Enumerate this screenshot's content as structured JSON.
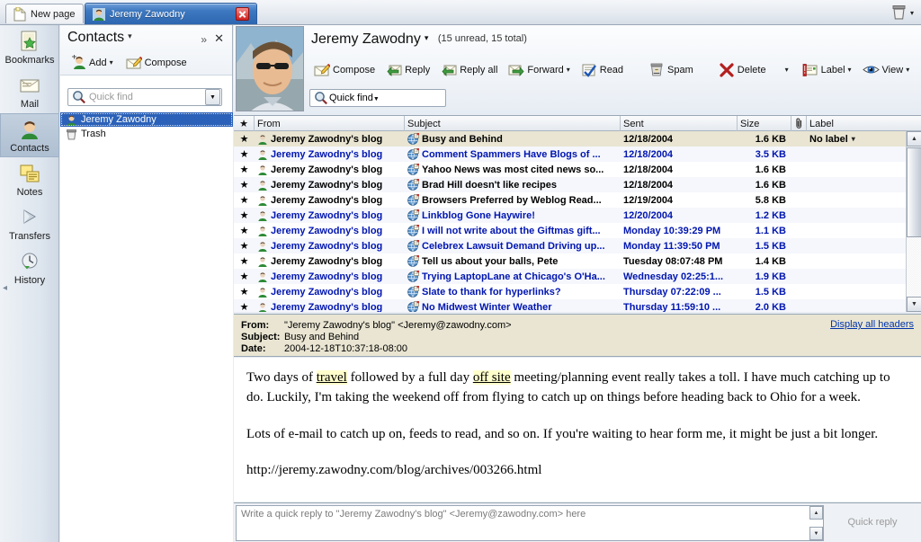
{
  "window": {
    "new_page_label": "New page",
    "active_tab_label": "Jeremy Zawodny",
    "trash_icon": "trash-icon",
    "trash_caret": "▾"
  },
  "sidebar": {
    "items": [
      {
        "label": "Bookmarks",
        "icon": "bookmarks-icon",
        "selected": false
      },
      {
        "label": "Mail",
        "icon": "mail-icon",
        "selected": false
      },
      {
        "label": "Contacts",
        "icon": "contacts-icon",
        "selected": true
      },
      {
        "label": "Notes",
        "icon": "notes-icon",
        "selected": false
      },
      {
        "label": "Transfers",
        "icon": "transfers-icon",
        "selected": false
      },
      {
        "label": "History",
        "icon": "history-icon",
        "selected": false
      }
    ],
    "collapse_arrow": "◂"
  },
  "contacts_panel": {
    "title": "Contacts",
    "title_caret": "▾",
    "expand_icon": "»",
    "close_icon": "✕",
    "add_label": "Add",
    "add_caret": "▾",
    "compose_label": "Compose",
    "quick_find_placeholder": "Quick find",
    "quick_find_value": "",
    "dropdown_caret": "▼",
    "list": [
      {
        "label": "Jeremy Zawodny",
        "icon": "person-icon",
        "selected": true
      },
      {
        "label": "Trash",
        "icon": "trash-icon",
        "selected": false
      }
    ]
  },
  "mail_header": {
    "title": "Jeremy Zawodny",
    "title_caret": "▾",
    "counts": "(15 unread, 15 total)",
    "avatar": "contact-photo",
    "quick_find_placeholder": "Quick find",
    "quick_find_value": "",
    "dropdown_caret": "▼",
    "toolbar": [
      {
        "label": "Compose",
        "icon": "compose-icon",
        "caret": ""
      },
      {
        "label": "Reply",
        "icon": "reply-icon",
        "caret": ""
      },
      {
        "label": "Reply all",
        "icon": "reply-all-icon",
        "caret": ""
      },
      {
        "label": "Forward",
        "icon": "forward-icon",
        "caret": "▾"
      },
      {
        "label": "Read",
        "icon": "read-icon",
        "caret": ""
      },
      {
        "label": "Spam",
        "icon": "spam-icon",
        "caret": ""
      },
      {
        "label": "Delete",
        "icon": "delete-icon",
        "caret": "▾"
      },
      {
        "label": "Label",
        "icon": "label-icon",
        "caret": "▾"
      },
      {
        "label": "View",
        "icon": "view-icon",
        "caret": "▾"
      }
    ]
  },
  "message_list": {
    "columns": [
      {
        "key": "star",
        "label": "★"
      },
      {
        "key": "from",
        "label": "From"
      },
      {
        "key": "subject",
        "label": "Subject"
      },
      {
        "key": "sent",
        "label": "Sent"
      },
      {
        "key": "size",
        "label": "Size"
      },
      {
        "key": "clip",
        "label": "attachment-icon"
      },
      {
        "key": "label",
        "label": "Label"
      }
    ],
    "rows": [
      {
        "star": "★",
        "from": "Jeremy Zawodny's blog",
        "subject": "Busy and Behind",
        "sent": "12/18/2004",
        "size": "1.6 KB",
        "label": "No label",
        "label_caret": "▾",
        "unread": false,
        "selected": true
      },
      {
        "star": "★",
        "from": "Jeremy Zawodny's blog",
        "subject": "Comment Spammers Have Blogs of ...",
        "sent": "12/18/2004",
        "size": "3.5 KB",
        "label": "",
        "label_caret": "",
        "unread": true,
        "selected": false
      },
      {
        "star": "★",
        "from": "Jeremy Zawodny's blog",
        "subject": "Yahoo News was most cited news so...",
        "sent": "12/18/2004",
        "size": "1.6 KB",
        "label": "",
        "label_caret": "",
        "unread": false,
        "selected": false
      },
      {
        "star": "★",
        "from": "Jeremy Zawodny's blog",
        "subject": "Brad Hill doesn't like recipes",
        "sent": "12/18/2004",
        "size": "1.6 KB",
        "label": "",
        "label_caret": "",
        "unread": false,
        "selected": false
      },
      {
        "star": "★",
        "from": "Jeremy Zawodny's blog",
        "subject": "Browsers Preferred by Weblog Read...",
        "sent": "12/19/2004",
        "size": "5.8 KB",
        "label": "",
        "label_caret": "",
        "unread": false,
        "selected": false
      },
      {
        "star": "★",
        "from": "Jeremy Zawodny's blog",
        "subject": "Linkblog Gone Haywire!",
        "sent": "12/20/2004",
        "size": "1.2 KB",
        "label": "",
        "label_caret": "",
        "unread": true,
        "selected": false
      },
      {
        "star": "★",
        "from": "Jeremy Zawodny's blog",
        "subject": "I will not write about the Giftmas gift...",
        "sent": "Monday 10:39:29 PM",
        "size": "1.1 KB",
        "label": "",
        "label_caret": "",
        "unread": true,
        "selected": false
      },
      {
        "star": "★",
        "from": "Jeremy Zawodny's blog",
        "subject": "Celebrex Lawsuit Demand Driving up...",
        "sent": "Monday 11:39:50 PM",
        "size": "1.5 KB",
        "label": "",
        "label_caret": "",
        "unread": true,
        "selected": false
      },
      {
        "star": "★",
        "from": "Jeremy Zawodny's blog",
        "subject": "Tell us about your balls, Pete",
        "sent": "Tuesday 08:07:48 PM",
        "size": "1.4 KB",
        "label": "",
        "label_caret": "",
        "unread": false,
        "selected": false
      },
      {
        "star": "★",
        "from": "Jeremy Zawodny's blog",
        "subject": "Trying LaptopLane at Chicago's O'Ha...",
        "sent": "Wednesday 02:25:1...",
        "size": "1.9 KB",
        "label": "",
        "label_caret": "",
        "unread": true,
        "selected": false
      },
      {
        "star": "★",
        "from": "Jeremy Zawodny's blog",
        "subject": "Slate to thank for hyperlinks?",
        "sent": "Thursday 07:22:09 ...",
        "size": "1.5 KB",
        "label": "",
        "label_caret": "",
        "unread": true,
        "selected": false
      },
      {
        "star": "★",
        "from": "Jeremy Zawodny's blog",
        "subject": "No Midwest Winter Weather",
        "sent": "Thursday 11:59:10 ...",
        "size": "2.0 KB",
        "label": "",
        "label_caret": "",
        "unread": true,
        "selected": false
      }
    ],
    "scroll_up": "▲",
    "scroll_down": "▼"
  },
  "header_pane": {
    "from_key": "From:",
    "from_value": "\"Jeremy Zawodny's blog\" <Jeremy@zawodny.com>",
    "subject_key": "Subject:",
    "subject_value": "Busy and Behind",
    "date_key": "Date:",
    "date_value": "2004-12-18T10:37:18-08:00",
    "display_all_headers": "Display all headers"
  },
  "body": {
    "p1_a": "Two days of ",
    "p1_link1": "travel",
    "p1_b": " followed by a full day ",
    "p1_link2": "off site",
    "p1_c": " meeting/planning event really takes a toll. I have much catching up to do. Luckily, I'm taking the weekend off from flying to catch up on things before heading back to Ohio for a week.",
    "p2": "Lots of e-mail to catch up on, feeds to read, and so on. If you're waiting to hear form me, it might be just a bit longer.",
    "url": "http://jeremy.zawodny.com/blog/archives/003266.html"
  },
  "quick_reply": {
    "placeholder": "Write a quick reply to \"Jeremy Zawodny's blog\" <Jeremy@zawodny.com> here",
    "value": "",
    "button_label": "Quick reply",
    "scroll_up": "▲",
    "scroll_down": "▼"
  },
  "colors": {
    "accent_blue": "#2d66b0",
    "unread_text": "#0015b0",
    "selected_row": "#e9e5d2",
    "header_pane": "#e9e5d2",
    "link_highlight": "#ffffcc"
  }
}
